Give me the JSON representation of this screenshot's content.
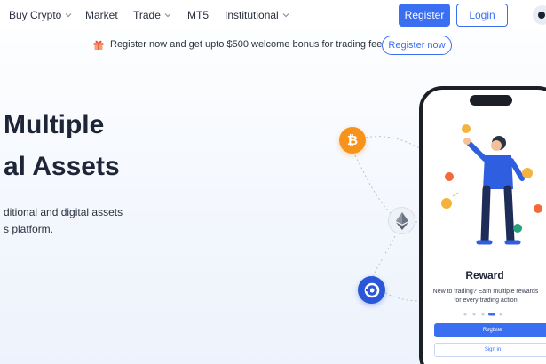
{
  "nav": {
    "items": [
      {
        "label": "Buy Crypto",
        "has_dropdown": true
      },
      {
        "label": "Market",
        "has_dropdown": false
      },
      {
        "label": "Trade",
        "has_dropdown": true
      },
      {
        "label": "MT5",
        "has_dropdown": false
      },
      {
        "label": "Institutional",
        "has_dropdown": true
      }
    ],
    "register_label": "Register",
    "login_label": "Login"
  },
  "promo": {
    "icon": "gift-icon",
    "text": "Register now and get upto $500 welcome bonus for trading fee rebates",
    "button_label": "Register now"
  },
  "hero": {
    "title_line1": "Multiple",
    "title_line2": "al Assets",
    "desc_line1": "ditional and digital assets",
    "desc_line2": "s platform."
  },
  "coins": [
    "bitcoin-icon",
    "ethereum-icon",
    "app-logo-icon"
  ],
  "phone": {
    "reward_title": "Reward",
    "reward_desc": "New to trading? Earn multiple rewards for every trading action",
    "register_label": "Register",
    "signin_label": "Sign in"
  },
  "colors": {
    "accent": "#3a6ff2",
    "bitcoin": "#f7931a",
    "tether": "#26a17b",
    "text": "#1e2536"
  }
}
